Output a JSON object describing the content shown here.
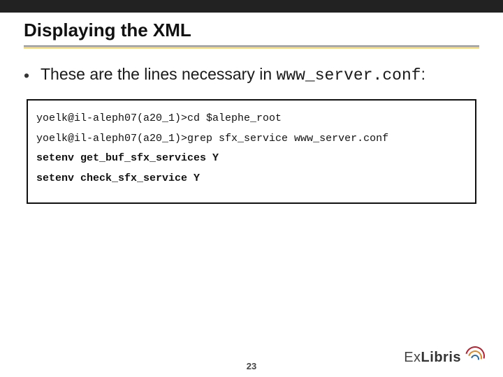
{
  "slide": {
    "title": "Displaying the XML",
    "bullet": {
      "marker": "•",
      "text_part1": "These are the lines necessary in ",
      "code_inline": "www_server.conf",
      "text_part2": ":"
    },
    "code_lines": [
      "yoelk@il-aleph07(a20_1)>cd $alephe_root",
      "yoelk@il-aleph07(a20_1)>grep sfx_service www_server.conf",
      "setenv get_buf_sfx_services Y",
      "setenv check_sfx_service Y"
    ],
    "page_number": "23",
    "logo": {
      "brand_thin": "Ex",
      "brand_bold": "Libris"
    }
  }
}
